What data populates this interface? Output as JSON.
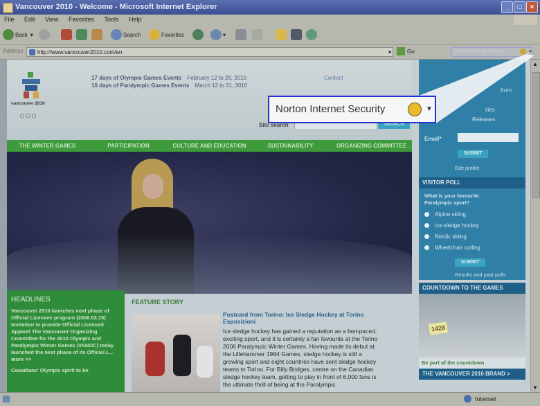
{
  "window": {
    "title": "Vancouver 2010 - Welcome - Microsoft Internet Explorer",
    "controls": [
      "_",
      "□",
      "×"
    ]
  },
  "menubar": [
    "File",
    "Edit",
    "View",
    "Favorites",
    "Tools",
    "Help"
  ],
  "toolbar": {
    "back_label": "Back",
    "search_label": "Search",
    "favorites_label": "Favorites"
  },
  "addressbar": {
    "label": "Address",
    "url": "http://www.vancouver2010.com/en",
    "go_label": "Go",
    "norton_label": "Norton Internet Security"
  },
  "callout": {
    "label": "Norton Internet Security"
  },
  "site": {
    "brand": "vancouver 2010",
    "games_line1": "17 days of Olympic Games Events",
    "games_line1_dates": "February 12 to 28, 2010",
    "games_line2": "10 days of Paralympic Games Events",
    "games_line2_dates": "March 12 to 21, 2010",
    "contact": "Contact",
    "search_label": "Site search",
    "search_button": "SEARCH",
    "nav": [
      "THE WINTER GAMES",
      "PARTICIPATION",
      "CULTURE AND EDUCATION",
      "SUSTAINABILITY",
      "ORGANIZING COMMITTEE"
    ],
    "signup": {
      "from": "from",
      "lines": "ilies",
      "releases": "Releases",
      "email_label": "Email*",
      "submit": "SUBMIT",
      "edit_profile": "Edit profile"
    },
    "poll": {
      "title": "VISITOR POLL",
      "question": "What is your favourite Paralympic sport?",
      "options": [
        "Alpine skiing",
        "Ice sledge hockey",
        "Nordic skiing",
        "Wheelchair curling"
      ],
      "submit": "SUBMIT",
      "results": "Results and past polls"
    },
    "countdown": {
      "title": "COUNTDOWN TO THE GAMES",
      "number": "1428",
      "link": "Be part of the countdown",
      "brand_bar": "THE VANCOUVER 2010 BRAND >"
    },
    "headlines": {
      "title": "HEADLINES",
      "text": "Vancouver 2010 launches next phase of Official Licensee program (2006.03.15) Invitation to provide Official Licensed Apparel The Vancouver Organizing Committee for the 2010 Olympic and Paralympic Winter Games (VANOC) today launched the next phase of its Official L... more >>",
      "text2": "Canadians' Olympic spirit to be"
    },
    "feature": {
      "label": "FEATURE STORY",
      "headline": "Postcard from Torino: Ice Sledge Hockey at Torino Esposizioni",
      "body": "Ice sledge hockey has gained a reputation as a fast-paced, exciting sport, and it is certainly a fan favourite at the Torino 2006 Paralympic Winter Games. Having made its debut at the Lillehammer 1994 Games, sledge hockey is still a growing sport and eight countries have sent sledge hockey teams to Torino. For Billy Bridges, centre on the Canadian sledge hockey team, getting to play in front of 6,000 fans is the ultimate thrill of being at the Paralympic"
    }
  },
  "statusbar": {
    "zone": "Internet"
  }
}
